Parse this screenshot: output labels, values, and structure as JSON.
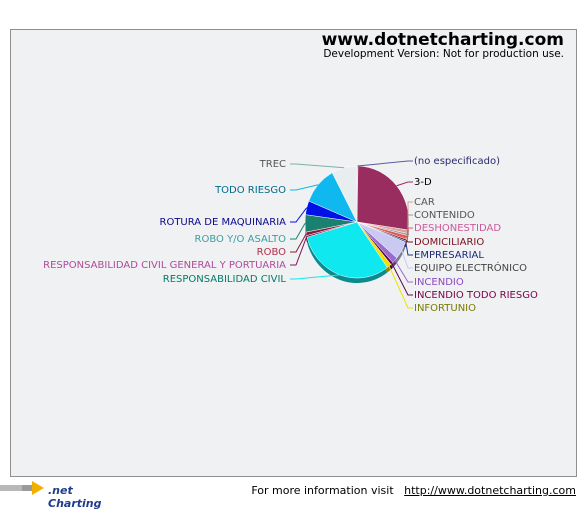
{
  "brand": {
    "title": "www.dotnetcharting.com",
    "subtitle": "Development Version: Not for production use."
  },
  "footer": {
    "logo_text": ".net Charting",
    "info_text": "For more information visit",
    "link_text": "http://www.dotnetcharting.com"
  },
  "chart_data": {
    "type": "pie",
    "legend": "none",
    "slices": [
      {
        "label": "(no especificado)",
        "value": 0.3,
        "color": "#5a5aa0"
      },
      {
        "label": "3-D",
        "value": 27.0,
        "color": "#9a2d5f"
      },
      {
        "label": "CAR",
        "value": 1.0,
        "color": "#d9a097"
      },
      {
        "label": "CONTENIDO",
        "value": 0.6,
        "color": "#9a9a9a"
      },
      {
        "label": "DESHONESTIDAD",
        "value": 1.1,
        "color": "#e05a5a"
      },
      {
        "label": "DOMICILIARIO",
        "value": 0.5,
        "color": "#7a1020"
      },
      {
        "label": "EMPRESARIAL",
        "value": 0.4,
        "color": "#1a3a8a"
      },
      {
        "label": "EQUIPO ELECTRÓNICO",
        "value": 5.2,
        "color": "#c9c9f2"
      },
      {
        "label": "INCENDIO",
        "value": 1.8,
        "color": "#9a6ad0"
      },
      {
        "label": "INCENDIO TODO RIESGO",
        "value": 0.8,
        "color": "#5a0a4a"
      },
      {
        "label": "INFORTUNIO",
        "value": 1.4,
        "color": "#f0e000"
      },
      {
        "label": "RESPONSABILIDAD CIVIL",
        "value": 30.5,
        "color": "#10e8f0"
      },
      {
        "label": "RESPONSABILIDAD CIVIL GENERAL Y PORTUARIA",
        "value": 0.5,
        "color": "#7a1a5a"
      },
      {
        "label": "ROBO",
        "value": 1.0,
        "color": "#8a1a3a"
      },
      {
        "label": "ROBO Y/O ASALTO",
        "value": 5.0,
        "color": "#1a8070"
      },
      {
        "label": "ROTURA DE MAQUINARIA",
        "value": 4.0,
        "color": "#0010e8"
      },
      {
        "label": "TODO RIESGO",
        "value": 11.0,
        "color": "#0fb8ee"
      },
      {
        "label": "TREC",
        "value": 7.9,
        "color": "#e8eef0"
      }
    ],
    "label_colors": {
      "(no especificado)": "#2a2a6a",
      "3-D": "#000000",
      "CAR": "#555555",
      "CONTENIDO": "#555555",
      "DESHONESTIDAD": "#cc5a9a",
      "DOMICILIARIO": "#7a1020",
      "EMPRESARIAL": "#1a2a7a",
      "EQUIPO ELECTRÓNICO": "#444444",
      "INCENDIO": "#8a4ac0",
      "INCENDIO TODO RIESGO": "#7a004a",
      "INFORTUNIO": "#7a7a00",
      "RESPONSABILIDAD CIVIL": "#007a6a",
      "RESPONSABILIDAD CIVIL GENERAL Y PORTUARIA": "#b04a9a",
      "ROBO": "#b0304a",
      "ROBO Y/O ASALTO": "#3aa0a0",
      "ROTURA DE MAQUINARIA": "#0a0a8a",
      "TODO RIESGO": "#006a8a",
      "TREC": "#555555"
    }
  }
}
